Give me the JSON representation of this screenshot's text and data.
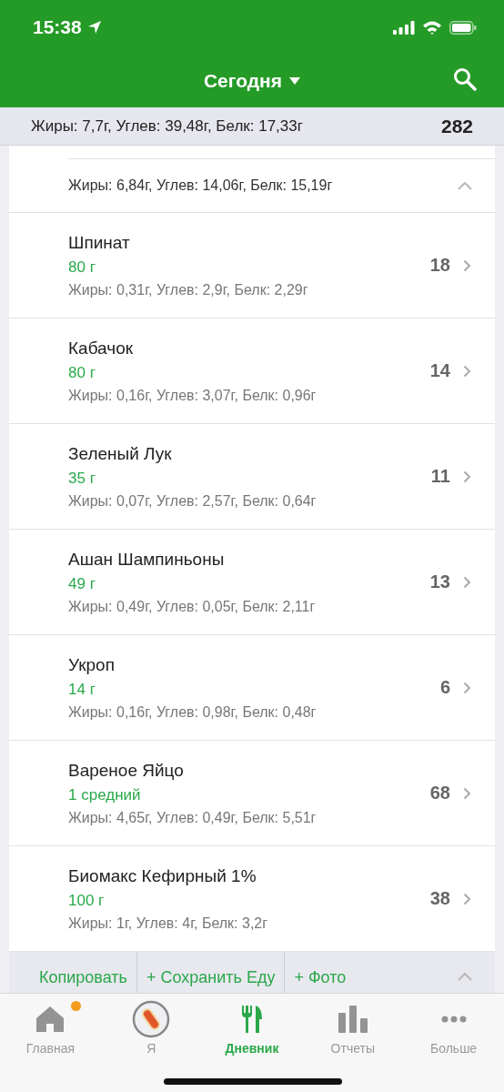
{
  "status_bar": {
    "time": "15:38"
  },
  "header": {
    "title": "Сегодня"
  },
  "summary": {
    "macros": "Жиры: 7,7г, Углев: 39,48г, Белк: 17,33г",
    "calories": "282"
  },
  "meal": {
    "macros": "Жиры: 6,84г, Углев: 14,06г, Белк: 15,19г",
    "expanded": true,
    "items": [
      {
        "name": "Шпинат",
        "amount": "80 г",
        "macros": "Жиры: 0,31г, Углев: 2,9г, Белк: 2,29г",
        "calories": "18"
      },
      {
        "name": "Кабачок",
        "amount": "80 г",
        "macros": "Жиры: 0,16г, Углев: 3,07г, Белк: 0,96г",
        "calories": "14"
      },
      {
        "name": "Зеленый Лук",
        "amount": "35 г",
        "macros": "Жиры: 0,07г, Углев: 2,57г, Белк: 0,64г",
        "calories": "11"
      },
      {
        "name": "Ашан Шампиньоны",
        "amount": "49 г",
        "macros": "Жиры: 0,49г, Углев: 0,05г, Белк: 2,11г",
        "calories": "13"
      },
      {
        "name": "Укроп",
        "amount": "14 г",
        "macros": "Жиры: 0,16г, Углев: 0,98г, Белк: 0,48г",
        "calories": "6"
      },
      {
        "name": "Вареное Яйцо",
        "amount": "1 средний",
        "macros": "Жиры: 4,65г, Углев: 0,49г, Белк: 5,51г",
        "calories": "68"
      },
      {
        "name": "Биомакс Кефирный 1%",
        "amount": "100 г",
        "macros": "Жиры: 1г, Углев: 4г, Белк: 3,2г",
        "calories": "38"
      }
    ],
    "actions": [
      "Копировать",
      "+ Сохранить Еду",
      "+ Фото"
    ]
  },
  "tabs": [
    {
      "kind": "home",
      "label": "Главная",
      "selected": false,
      "badge": true
    },
    {
      "kind": "avatar",
      "label": "Я",
      "selected": false,
      "badge": false
    },
    {
      "kind": "diary",
      "label": "Дневник",
      "selected": true,
      "badge": false
    },
    {
      "kind": "reports",
      "label": "Отчеты",
      "selected": false,
      "badge": false
    },
    {
      "kind": "more",
      "label": "Больше",
      "selected": false,
      "badge": false
    }
  ]
}
